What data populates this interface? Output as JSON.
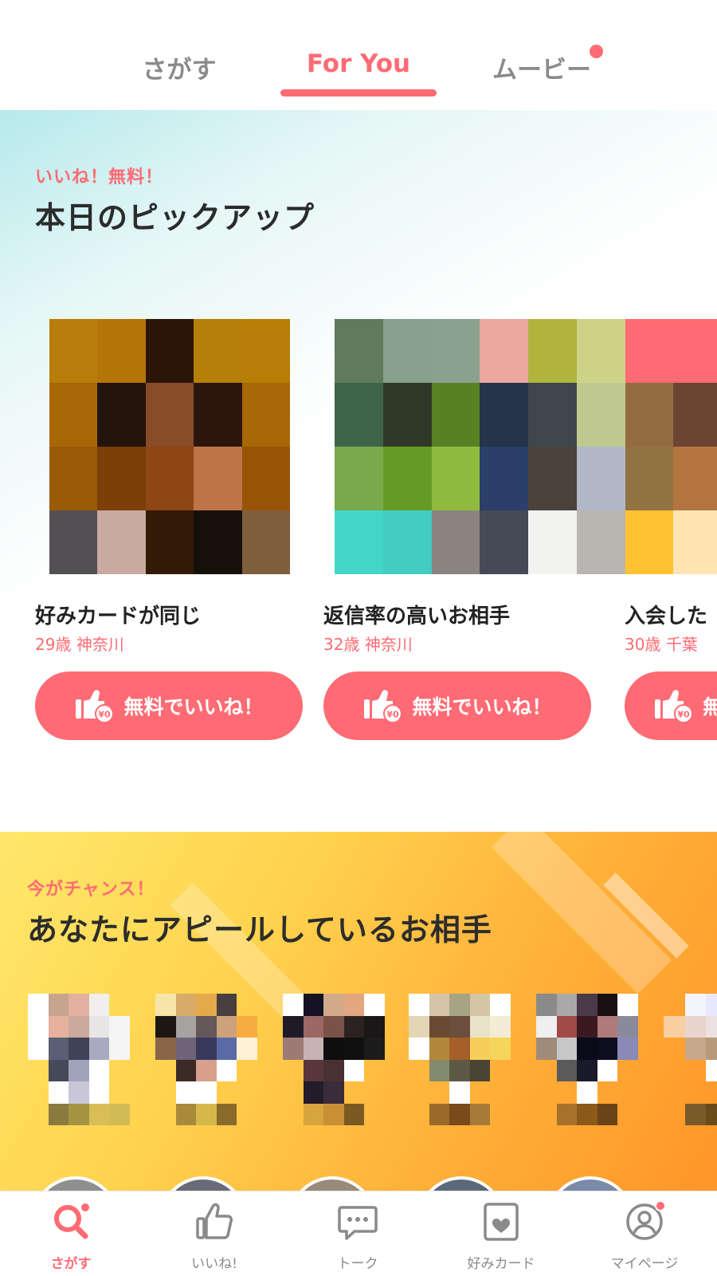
{
  "top_tabs": {
    "sagasu": "さがす",
    "for_you": "For You",
    "movie": "ムービー",
    "active": "For You",
    "movie_has_notification": true
  },
  "pickup": {
    "sub_label": "いいね！無料！",
    "title": "本日のピックアップ",
    "cards": [
      {
        "name": "好みカードが同じ",
        "age": "29歳",
        "location": "神奈川",
        "button": "無料でいいね！",
        "button_badge": "¥0"
      },
      {
        "name": "返信率の高いお相手",
        "age": "32歳",
        "location": "神奈川",
        "button": "無料でいいね！",
        "button_badge": "¥0"
      },
      {
        "name": "入会した",
        "age": "30歳",
        "location": "千葉",
        "button": "無",
        "button_badge": "¥0"
      }
    ]
  },
  "appeal": {
    "sub_label": "今がチャンス！",
    "title": "あなたにアピールしているお相手"
  },
  "bottom_nav": {
    "items": [
      {
        "label": "さがす",
        "icon": "search-icon",
        "active": true,
        "badge": true
      },
      {
        "label": "いいね!",
        "icon": "thumbs-up-icon",
        "active": false,
        "badge": false
      },
      {
        "label": "トーク",
        "icon": "chat-bubble-icon",
        "active": false,
        "badge": false
      },
      {
        "label": "好みカード",
        "icon": "heart-card-icon",
        "active": false,
        "badge": false
      },
      {
        "label": "マイページ",
        "icon": "profile-icon",
        "active": false,
        "badge": true
      }
    ]
  },
  "colors": {
    "accent": "#ff6b74",
    "text": "#2c2c2c",
    "inactive": "#8a8a8a"
  }
}
